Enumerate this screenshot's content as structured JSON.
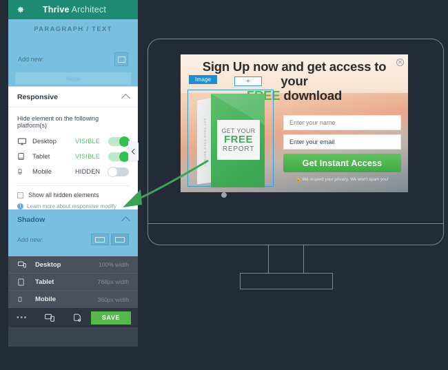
{
  "app": {
    "title_bold": "Thrive",
    "title_light": "Architect",
    "gear_icon": "gear-icon"
  },
  "paragraph_panel": {
    "label": "PARAGRAPH / TEXT",
    "add_new_label": "Add new:",
    "none_label": "None"
  },
  "responsive_panel": {
    "title": "Responsive",
    "collapse_icon": "chevron-up-icon",
    "hide_note": "Hide element on the following platform(s)",
    "devices": [
      {
        "icon": "desktop-icon",
        "name": "Desktop",
        "state": "VISIBLE",
        "toggle": "on"
      },
      {
        "icon": "tablet-icon",
        "name": "Tablet",
        "state": "VISIBLE",
        "toggle": "on"
      },
      {
        "icon": "mobile-icon",
        "name": "Mobile",
        "state": "HIDDEN",
        "toggle": "off"
      }
    ],
    "show_hidden_label": "Show all hidden elements",
    "learn_more_label": "Learn more about responsive modify",
    "info_icon_char": "i"
  },
  "shadow_panel": {
    "title": "Shadow",
    "collapse_icon": "chevron-up-icon",
    "add_new_label": "Add new:",
    "preset_one": "shadow-preset-1",
    "preset_two": "shadow-preset-2"
  },
  "device_list": [
    {
      "icon": "desktop-preview-icon",
      "name": "Desktop",
      "width": "100% width"
    },
    {
      "icon": "tablet-preview-icon",
      "name": "Tablet",
      "width": "768px width"
    },
    {
      "icon": "mobile-preview-icon",
      "name": "Mobile",
      "width": "360px width"
    }
  ],
  "bottom_bar": {
    "more_label": "•••",
    "preview_icon": "responsive-preview-icon",
    "revision_icon": "revision-manager-icon",
    "save_label": "SAVE"
  },
  "collapse_handle": {
    "icon": "chevron-left-icon"
  },
  "popup": {
    "headline_line1": "Sign Up now and get access to your",
    "headline_free": "FREE",
    "headline_rest": " download",
    "close_icon": "close-icon",
    "image_badge": "Image",
    "plus_button": "+",
    "book": {
      "spine_text": "GET YOUR FREE REPORT",
      "cover_line1": "GET YOUR",
      "cover_line2": "FREE",
      "cover_line3": "REPORT"
    },
    "form": {
      "name_placeholder": "Enter your name",
      "email_placeholder": "Enter your email",
      "cta_label": "Get Instant Access",
      "privacy_note": "🔒 We respect your privacy. We won't spam you!"
    }
  },
  "colors": {
    "canvas_bg": "#222b36",
    "titlebar_green": "#1f8a72",
    "panel_blue": "#79c0e0",
    "accent_green": "#54b948",
    "toggle_on": "#2fc04f",
    "selection_blue": "#2f9fd8",
    "monitor_stroke": "#7b8794",
    "arrow_green": "#3ba356"
  }
}
